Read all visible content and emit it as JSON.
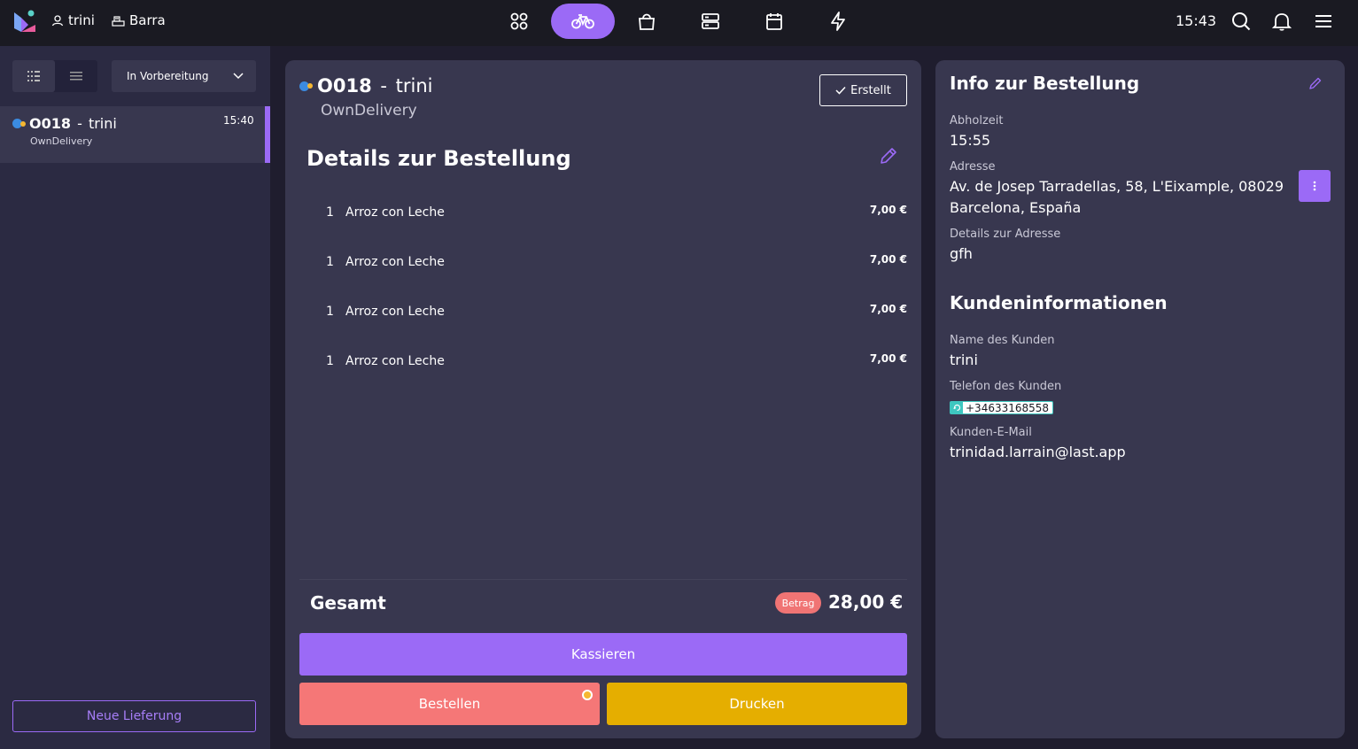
{
  "topbar": {
    "user": "trini",
    "location": "Barra",
    "clock": "15:43",
    "nav_icons": [
      "apps-icon",
      "bike-icon",
      "bag-icon",
      "server-icon",
      "calendar-icon",
      "lightning-icon"
    ],
    "accent_color": "#9b6af6"
  },
  "sidebar": {
    "status_filter": "In Vorbereitung",
    "order": {
      "number": "O018",
      "separator": " - ",
      "customer": "trini",
      "channel": "OwnDelivery",
      "time": "15:40"
    },
    "new_delivery_label": "Neue Lieferung"
  },
  "order_detail": {
    "number": "O018",
    "separator": " - ",
    "customer": "trini",
    "channel": "OwnDelivery",
    "status_label": "Erstellt",
    "heading": "Details zur Bestellung",
    "items": [
      {
        "qty": "1",
        "name": "Arroz con Leche",
        "price": "7,00 €"
      },
      {
        "qty": "1",
        "name": "Arroz con Leche",
        "price": "7,00 €"
      },
      {
        "qty": "1",
        "name": "Arroz con Leche",
        "price": "7,00 €"
      },
      {
        "qty": "1",
        "name": "Arroz con Leche",
        "price": "7,00 €"
      }
    ],
    "total_label": "Gesamt",
    "total_badge": "Betrag",
    "total_value": "28,00 €",
    "pay_label": "Kassieren",
    "order_label": "Bestellen",
    "print_label": "Drucken"
  },
  "info": {
    "heading": "Info zur Bestellung",
    "pickup_label": "Abholzeit",
    "pickup_value": "15:55",
    "address_label": "Adresse",
    "address_line1": "Av. de Josep Tarradellas, 58, L'Eixample, 08029",
    "address_line2": "Barcelona, España",
    "address_details_label": "Details zur Adresse",
    "address_details_value": "gfh",
    "customer_heading": "Kundeninformationen",
    "customer_name_label": "Name des Kunden",
    "customer_name_value": "trini",
    "customer_phone_label": "Telefon des Kunden",
    "customer_phone_value": "+34633168558",
    "customer_email_label": "Kunden-E-Mail",
    "customer_email_value": "trinidad.larrain@last.app"
  }
}
